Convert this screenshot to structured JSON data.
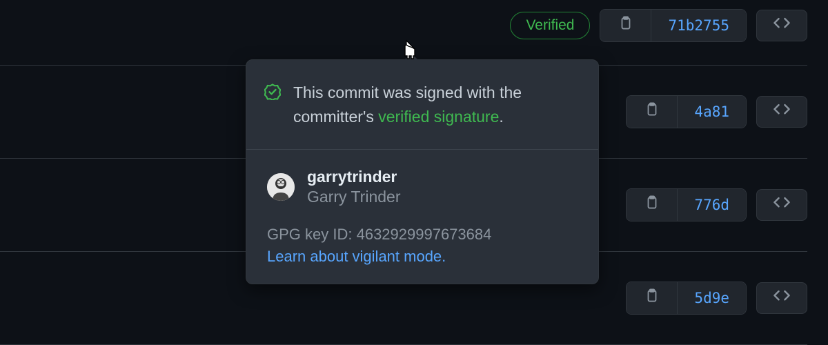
{
  "commits": [
    {
      "verified_label": "Verified",
      "sha": "71b2755"
    },
    {
      "sha": "4a81"
    },
    {
      "sha": "776d"
    },
    {
      "sha": "5d9e"
    }
  ],
  "popover": {
    "message_prefix": "This commit was signed with the committer's ",
    "message_highlight": "verified signature",
    "message_suffix": ".",
    "username": "garrytrinder",
    "fullname": "Garry Trinder",
    "gpg_label": "GPG key ID: ",
    "gpg_value": "4632929997673684",
    "learn_link": "Learn about vigilant mode."
  }
}
